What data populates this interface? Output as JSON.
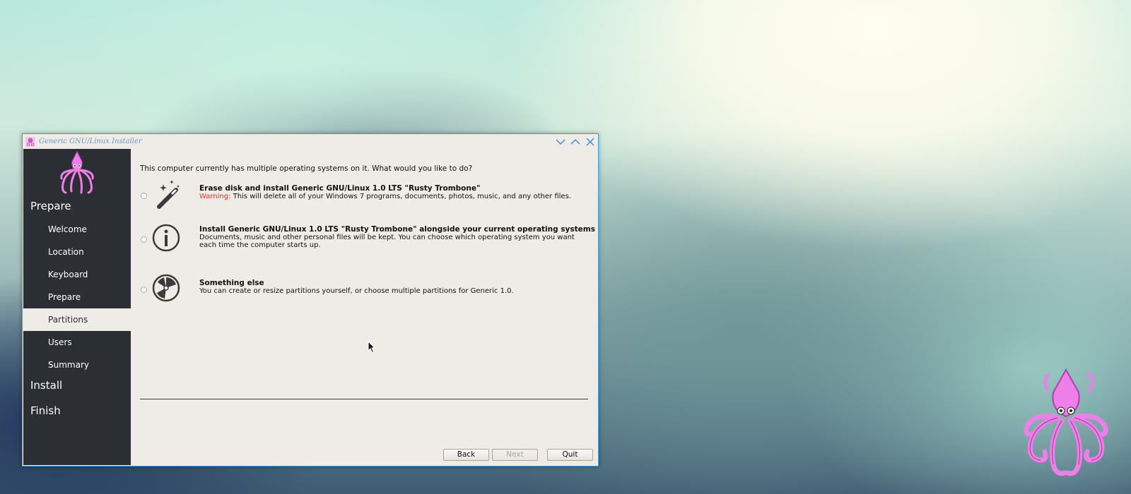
{
  "window": {
    "title": "Generic GNU/Linux Installer",
    "controls": [
      "minimize",
      "maximize",
      "close"
    ]
  },
  "sidebar": {
    "sections": [
      {
        "label": "Prepare"
      },
      {
        "label": "Install"
      },
      {
        "label": "Finish"
      }
    ],
    "steps": [
      {
        "label": "Welcome",
        "active": false
      },
      {
        "label": "Location",
        "active": false
      },
      {
        "label": "Keyboard",
        "active": false
      },
      {
        "label": "Prepare",
        "active": false
      },
      {
        "label": "Partitions",
        "active": true
      },
      {
        "label": "Users",
        "active": false
      },
      {
        "label": "Summary",
        "active": false
      }
    ]
  },
  "main": {
    "question": "This computer currently has multiple operating systems on it. What would you like to do?",
    "options": [
      {
        "icon": "magic-wand-icon",
        "title": "Erase disk and install Generic GNU/Linux 1.0 LTS \"Rusty Trombone\"",
        "warning_label": "Warning:",
        "description": " This will delete all of your Windows 7 programs, documents, photos, music, and any other files.",
        "selected": false
      },
      {
        "icon": "info-icon",
        "title": "Install Generic GNU/Linux 1.0 LTS \"Rusty Trombone\" alongside your current operating systems",
        "description": "Documents, music and other personal files will be kept. You can choose which operating system you want each time the computer starts up.",
        "selected": false
      },
      {
        "icon": "partition-disk-icon",
        "title": "Something else",
        "description": "You can create or resize partitions yourself, or choose multiple partitions for Generic 1.0.",
        "selected": false
      }
    ]
  },
  "buttons": {
    "back": "Back",
    "next": "Next",
    "quit": "Quit"
  },
  "colors": {
    "sidebar_bg": "#2b2e33",
    "window_bg": "#efebe7",
    "accent_border": "#3d9ee0",
    "warning": "#e0372a",
    "mascot": "#ee7fe8"
  }
}
